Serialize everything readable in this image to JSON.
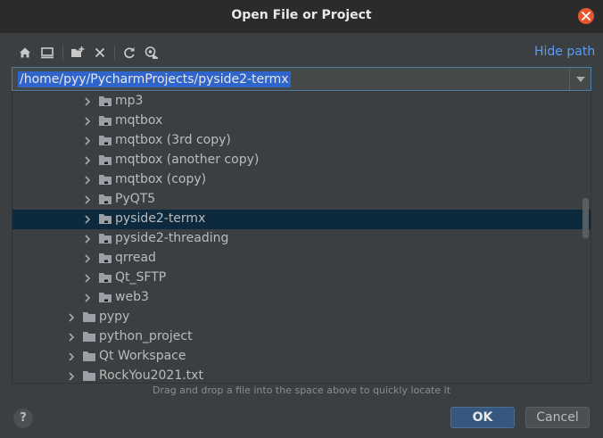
{
  "dialog": {
    "title": "Open File or Project"
  },
  "toolbar": {
    "icons": [
      "home-icon",
      "desktop-icon",
      "new-folder-icon",
      "delete-icon",
      "refresh-icon",
      "show-hidden-icon"
    ],
    "hide_path_label": "Hide path"
  },
  "path": {
    "value": "/home/pyy/PycharmProjects/pyside2-termx"
  },
  "tree": {
    "items": [
      {
        "label": "mp3",
        "level": 1,
        "selected": false
      },
      {
        "label": "mqtbox",
        "level": 1,
        "selected": false
      },
      {
        "label": "mqtbox (3rd copy)",
        "level": 1,
        "selected": false
      },
      {
        "label": "mqtbox (another copy)",
        "level": 1,
        "selected": false
      },
      {
        "label": "mqtbox (copy)",
        "level": 1,
        "selected": false
      },
      {
        "label": "PyQT5",
        "level": 1,
        "selected": false
      },
      {
        "label": "pyside2-termx",
        "level": 1,
        "selected": true
      },
      {
        "label": "pyside2-threading",
        "level": 1,
        "selected": false
      },
      {
        "label": "qrread",
        "level": 1,
        "selected": false
      },
      {
        "label": "Qt_SFTP",
        "level": 1,
        "selected": false
      },
      {
        "label": "web3",
        "level": 1,
        "selected": false
      },
      {
        "label": "pypy",
        "level": 0,
        "selected": false
      },
      {
        "label": "python_project",
        "level": 0,
        "selected": false
      },
      {
        "label": "Qt Workspace",
        "level": 0,
        "selected": false
      },
      {
        "label": "RockYou2021.txt",
        "level": 0,
        "selected": false
      }
    ]
  },
  "hint": {
    "text": "Drag and drop a file into the space above to quickly locate it"
  },
  "buttons": {
    "help_label": "?",
    "ok_label": "OK",
    "cancel_label": "Cancel"
  },
  "colors": {
    "accent": "#589df6",
    "selection": "#0d293e",
    "ok_button": "#365880",
    "close_button": "#e9542d"
  }
}
